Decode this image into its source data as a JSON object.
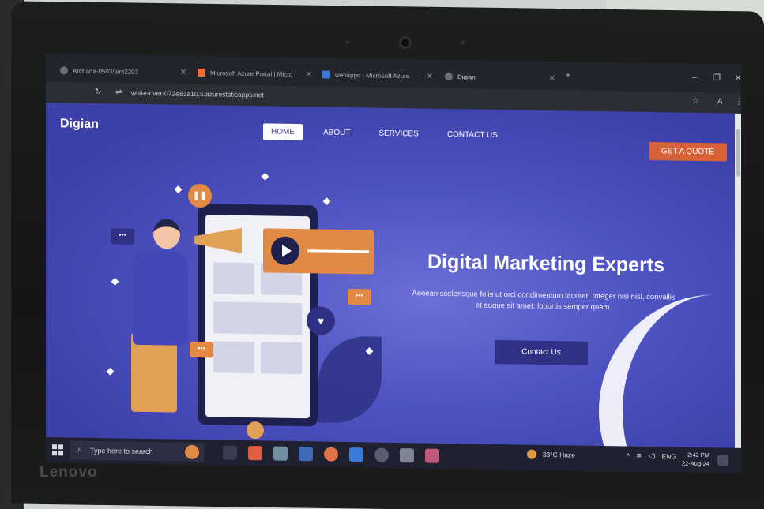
{
  "browser": {
    "tabs": [
      {
        "label": "Archana-0503/aim2203"
      },
      {
        "label": "Microsoft Azure Portal | Micro"
      },
      {
        "label": "webapps - Microsoft Azure"
      },
      {
        "label": "Digian"
      }
    ],
    "url": "white-river-072e83a10.5.azurestaticapps.net"
  },
  "site": {
    "logo": "Digian",
    "nav": [
      "HOME",
      "ABOUT",
      "SERVICES",
      "CONTACT US"
    ],
    "quote_button": "GET A QUOTE",
    "hero": {
      "title": "Digital Marketing Experts",
      "subtitle": "Aenean scelerisque felis ut orci condimentum laoreet. Integer nisi nisl, convallis et augue sit amet, lobortis semper quam.",
      "button": "Contact Us"
    },
    "colors": {
      "accent": "#d76239",
      "primary": "#4e53c2",
      "dark": "#2e3184"
    }
  },
  "taskbar": {
    "search_placeholder": "Type here to search",
    "weather": "33°C  Haze",
    "language": "ENG",
    "time": "2:42 PM",
    "date": "22-Aug-24"
  },
  "laptop_brand": "Lenovo"
}
